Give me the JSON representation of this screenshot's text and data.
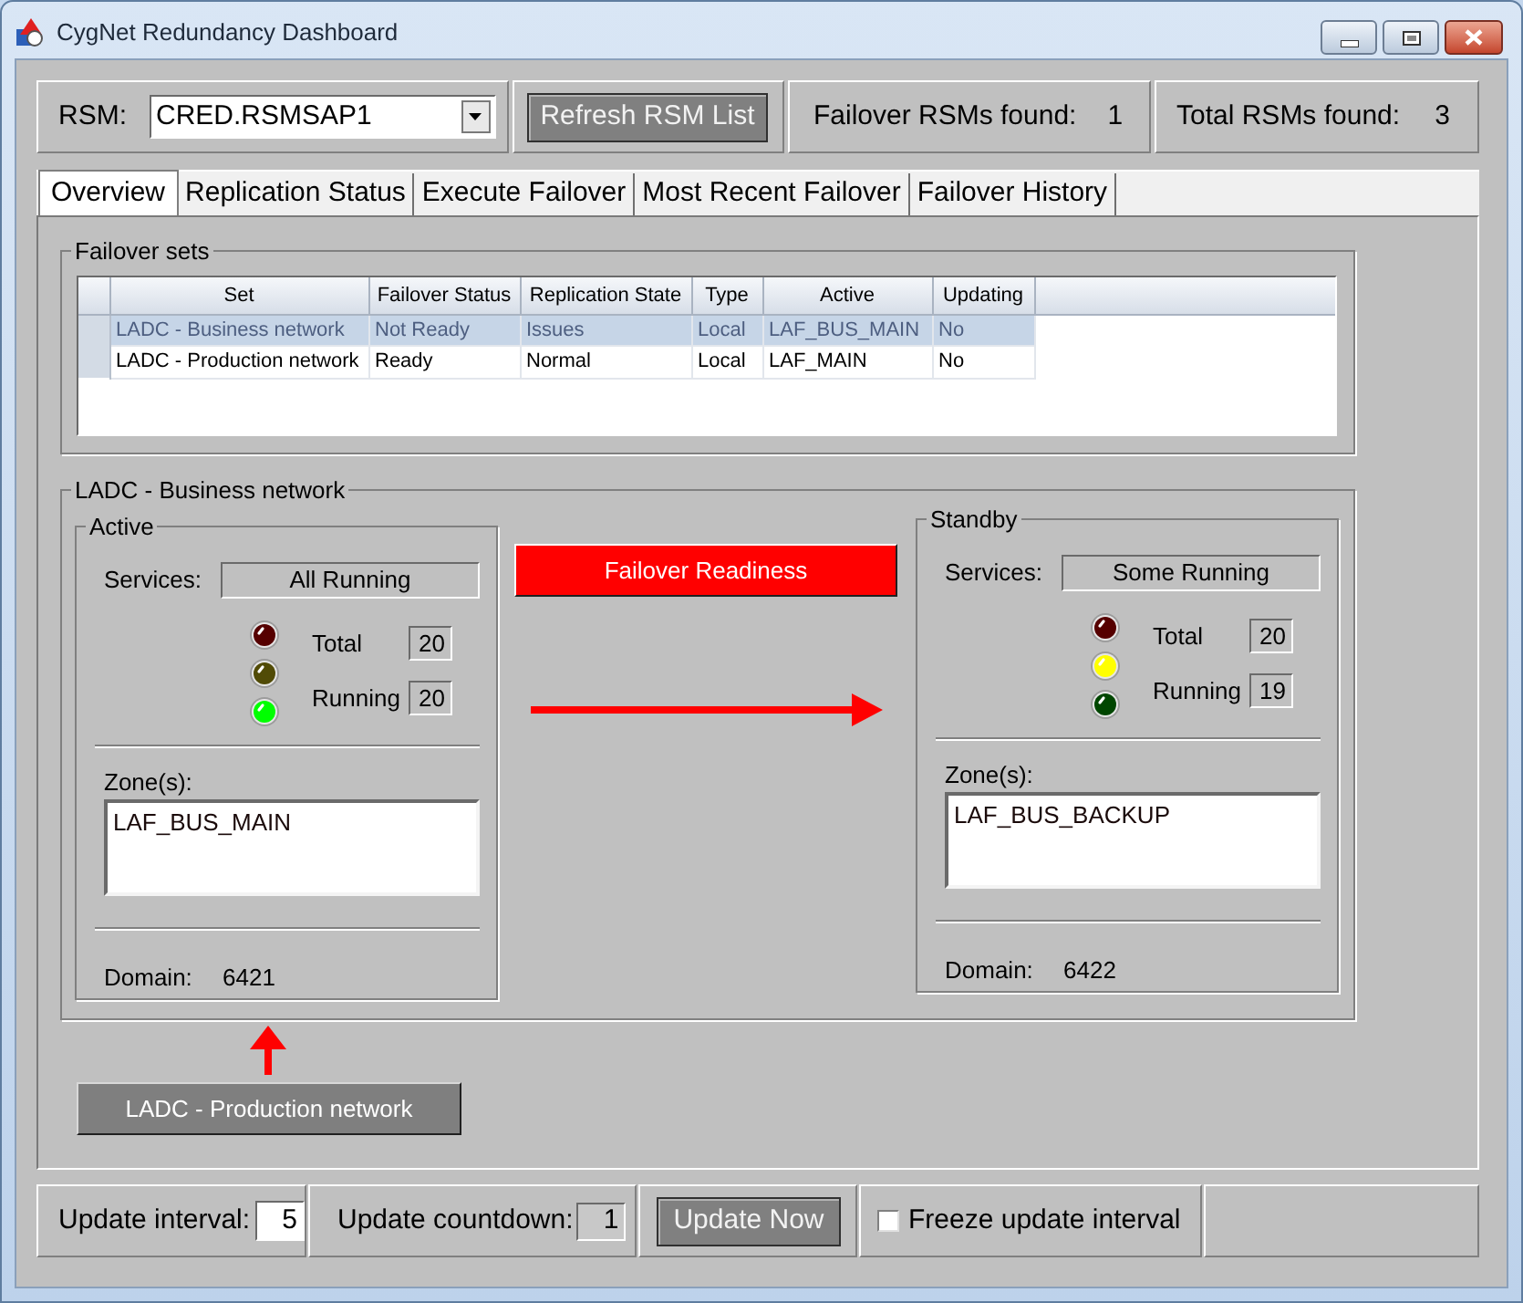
{
  "window": {
    "title": "CygNet Redundancy Dashboard"
  },
  "toolbar": {
    "rsm_label": "RSM:",
    "rsm_value": "CRED.RSMSAP1",
    "refresh_button": "Refresh RSM List",
    "failover_label": "Failover RSMs found:",
    "failover_count": "1",
    "total_label": "Total RSMs found:",
    "total_count": "3"
  },
  "tabs": [
    {
      "label": "Overview",
      "selected": true
    },
    {
      "label": "Replication Status",
      "selected": false
    },
    {
      "label": "Execute Failover",
      "selected": false
    },
    {
      "label": "Most Recent Failover",
      "selected": false
    },
    {
      "label": "Failover History",
      "selected": false
    }
  ],
  "failover_sets": {
    "title": "Failover sets",
    "columns": [
      "Set",
      "Failover Status",
      "Replication State",
      "Type",
      "Active",
      "Updating"
    ],
    "rows": [
      {
        "selected": true,
        "cells": [
          "LADC - Business network",
          "Not Ready",
          "Issues",
          "Local",
          "LAF_BUS_MAIN",
          "No"
        ]
      },
      {
        "selected": false,
        "cells": [
          "LADC - Production network",
          "Ready",
          "Normal",
          "Local",
          "LAF_MAIN",
          "No"
        ]
      }
    ]
  },
  "set_detail": {
    "title": "LADC - Business network",
    "readiness_button": "Failover Readiness",
    "panels": [
      {
        "title": "Active",
        "services_label": "Services:",
        "services_value": "All Running",
        "lights": [
          {
            "kind": "red",
            "on": false
          },
          {
            "kind": "yellow",
            "on": false
          },
          {
            "kind": "green",
            "on": true
          }
        ],
        "total_label": "Total",
        "total_value": "20",
        "running_label": "Running",
        "running_value": "20",
        "zones_label": "Zone(s):",
        "zones": [
          "LAF_BUS_MAIN"
        ],
        "domain_label": "Domain:",
        "domain_value": "6421"
      },
      {
        "title": "Standby",
        "services_label": "Services:",
        "services_value": "Some Running",
        "lights": [
          {
            "kind": "red",
            "on": false
          },
          {
            "kind": "yellow",
            "on": true
          },
          {
            "kind": "green",
            "on": false
          }
        ],
        "total_label": "Total",
        "total_value": "20",
        "running_label": "Running",
        "running_value": "19",
        "zones_label": "Zone(s):",
        "zones": [
          "LAF_BUS_BACKUP"
        ],
        "domain_label": "Domain:",
        "domain_value": "6422"
      }
    ]
  },
  "switch_button": "LADC - Production network",
  "footer": {
    "interval_label": "Update interval:",
    "interval_value": "5",
    "countdown_label": "Update countdown:",
    "countdown_value": "1",
    "update_button": "Update Now",
    "freeze": {
      "label": "Freeze update interval",
      "checked": false
    }
  }
}
